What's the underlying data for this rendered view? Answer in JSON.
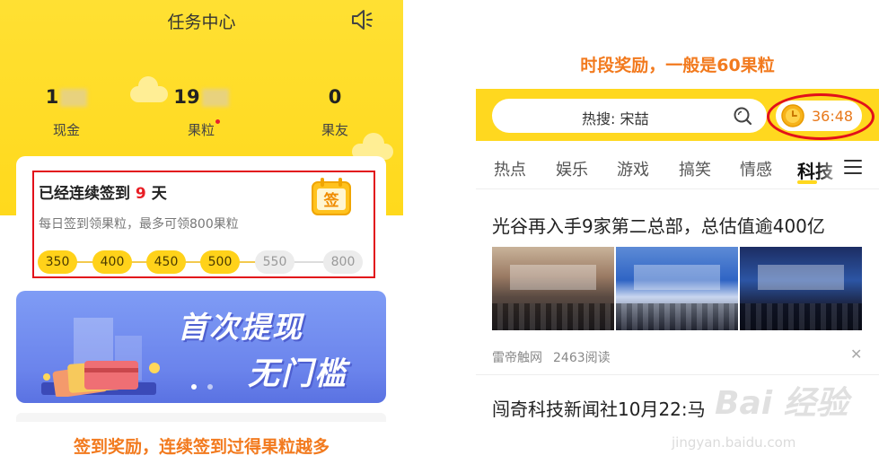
{
  "left": {
    "title": "任务中心",
    "stats": [
      {
        "value": "1",
        "label": "现金"
      },
      {
        "value": "19",
        "label": "果粒"
      },
      {
        "value": "0",
        "label": "果友"
      }
    ],
    "checkin": {
      "title_prefix": "已经连续签到",
      "days": "9",
      "title_suffix": "天",
      "subtitle": "每日签到领果粒，最多可领800果粒",
      "icon_label": "签",
      "rewards": [
        "350",
        "400",
        "450",
        "500",
        "550",
        "800"
      ],
      "claimed_count": 4
    },
    "banner": {
      "line1": "首次提现",
      "line2": "无门槛"
    },
    "caption": "签到奖励，连续签到过得果粒越多"
  },
  "right": {
    "caption": "时段奖励，一般是60果粒",
    "search": {
      "text": "热搜: 宋喆"
    },
    "timer": "36:48",
    "tabs": [
      "热点",
      "娱乐",
      "游戏",
      "搞笑",
      "情感",
      "科技"
    ],
    "active_tab": "科技",
    "article1": {
      "title": "光谷再入手9家第二总部，总估值逾400亿",
      "source": "雷帝触网",
      "reads": "2463阅读"
    },
    "article2": {
      "title": "闯奇科技新闻社10月22:马"
    }
  },
  "watermark": {
    "text": "Bai 经验",
    "url": "jingyan.baidu.com"
  },
  "colors": {
    "brand_yellow": "#ffd81f",
    "highlight_red": "#e2101a",
    "caption_orange": "#f27a1e",
    "banner_blue": "#6b84ec"
  }
}
